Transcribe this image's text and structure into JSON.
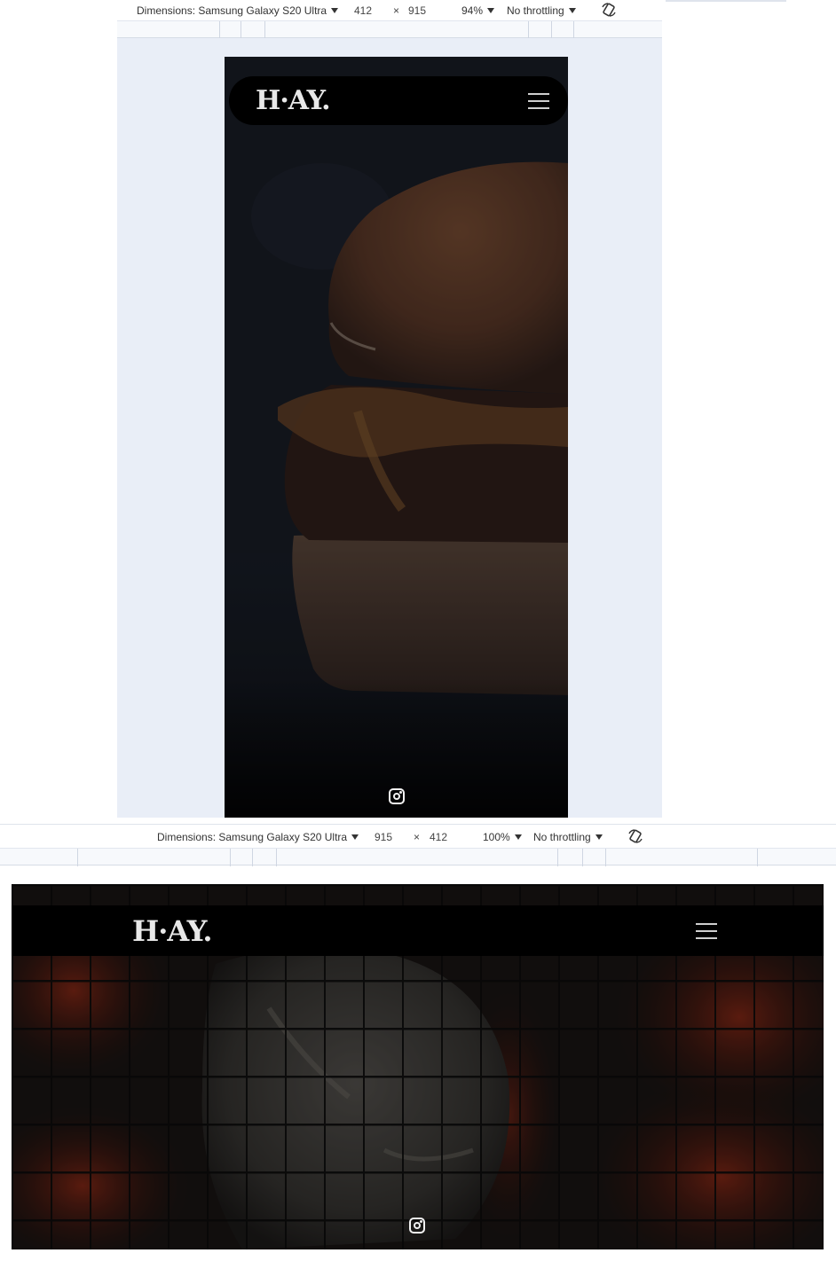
{
  "devtools_top": {
    "device_label": "Dimensions: Samsung Galaxy S20 Ultra",
    "width": "412",
    "times": "×",
    "height": "915",
    "zoom": "94%",
    "throttling": "No throttling"
  },
  "devtools_bottom": {
    "device_label": "Dimensions: Samsung Galaxy S20 Ultra",
    "width": "915",
    "times": "×",
    "height": "412",
    "zoom": "100%",
    "throttling": "No throttling"
  },
  "site": {
    "logo_text": "H·AY.",
    "menu_icon": "hamburger-menu-icon",
    "social_icon": "instagram-icon"
  },
  "colors": {
    "nav_bg": "#000000",
    "devtools_bg": "#e9eef7",
    "logo": "#e8e8e8"
  }
}
